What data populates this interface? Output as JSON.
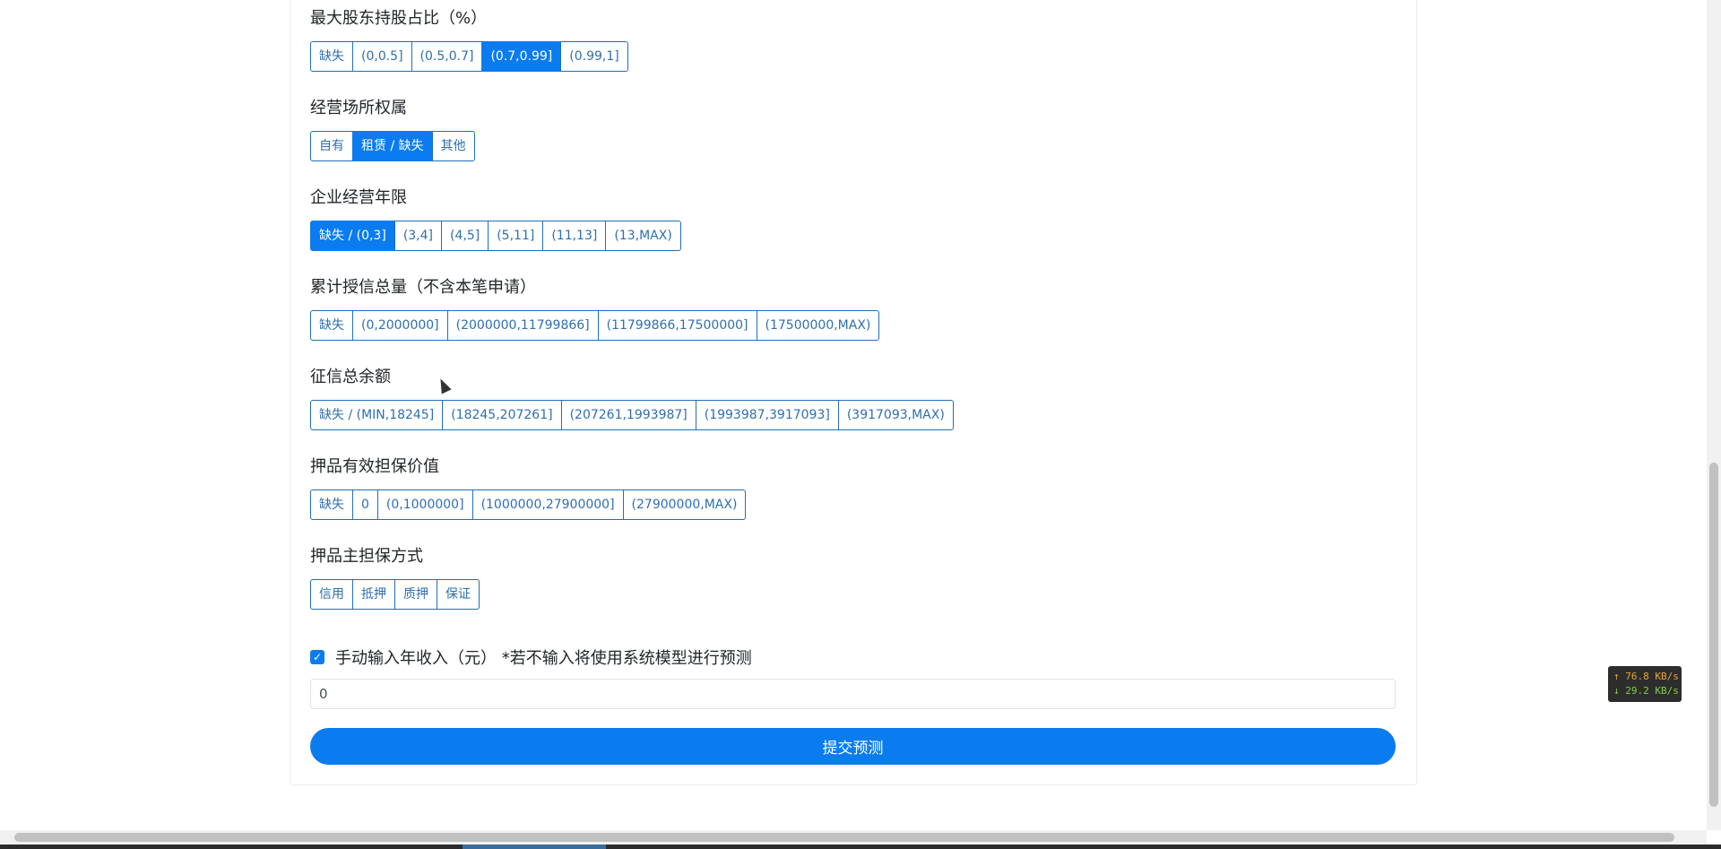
{
  "sections": [
    {
      "title": "最大股东持股占比（%）",
      "options": [
        "缺失",
        "(0,0.5]",
        "(0.5,0.7]",
        "(0.7,0.99]",
        "(0.99,1]"
      ],
      "selected": 3
    },
    {
      "title": "经营场所权属",
      "options": [
        "自有",
        "租赁 / 缺失",
        "其他"
      ],
      "selected": 1
    },
    {
      "title": "企业经营年限",
      "options": [
        "缺失 / (0,3]",
        "(3,4]",
        "(4,5]",
        "(5,11]",
        "(11,13]",
        "(13,MAX)"
      ],
      "selected": 0
    },
    {
      "title": "累计授信总量（不含本笔申请）",
      "options": [
        "缺失",
        "(0,2000000]",
        "(2000000,11799866]",
        "(11799866,17500000]",
        "(17500000,MAX)"
      ],
      "selected": -1
    },
    {
      "title": "征信总余额",
      "options": [
        "缺失 / (MIN,18245]",
        "(18245,207261]",
        "(207261,1993987]",
        "(1993987,3917093]",
        "(3917093,MAX)"
      ],
      "selected": -1
    },
    {
      "title": "押品有效担保价值",
      "options": [
        "缺失",
        "0",
        "(0,1000000]",
        "(1000000,27900000]",
        "(27900000,MAX)"
      ],
      "selected": -1
    },
    {
      "title": "押品主担保方式",
      "options": [
        "信用",
        "抵押",
        "质押",
        "保证"
      ],
      "selected": -1
    }
  ],
  "manual_income": {
    "checked": true,
    "label": "手动输入年收入（元） *若不输入将使用系统模型进行预测",
    "value": "0"
  },
  "submit_label": "提交预测",
  "network": {
    "up": "↑ 76.8 KB/s",
    "down": "↓ 29.2 KB/s"
  },
  "colors": {
    "primary": "#0a7cf0",
    "option_border": "#1f6fb8",
    "option_text": "#2f6fb0"
  }
}
